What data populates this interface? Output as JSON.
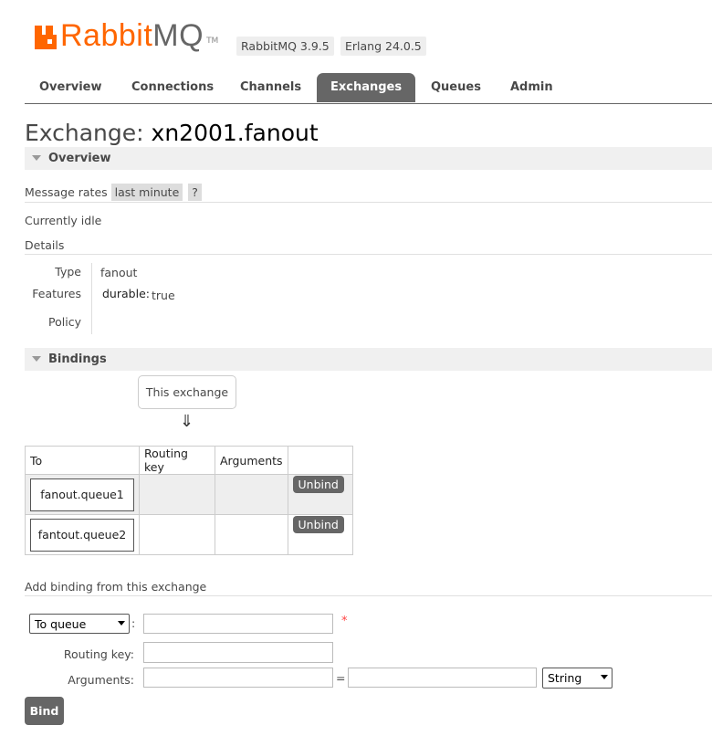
{
  "header": {
    "brand_rabbit": "Rabbit",
    "brand_mq": "MQ",
    "brand_tm": "TM",
    "rabbitmq_version": "RabbitMQ 3.9.5",
    "erlang_version": "Erlang 24.0.5"
  },
  "tabs": [
    {
      "label": "Overview"
    },
    {
      "label": "Connections"
    },
    {
      "label": "Channels"
    },
    {
      "label": "Exchanges"
    },
    {
      "label": "Queues"
    },
    {
      "label": "Admin"
    }
  ],
  "page": {
    "title_prefix": "Exchange: ",
    "title_name": "xn2001.fanout"
  },
  "overview": {
    "section_label": "Overview",
    "message_rates_label": "Message rates",
    "message_rates_period": "last minute",
    "help_label": "?",
    "status": "Currently idle",
    "details_label": "Details",
    "type_label": "Type",
    "type_value": "fanout",
    "features_label": "Features",
    "feature_key": "durable:",
    "feature_value": "true",
    "policy_label": "Policy"
  },
  "bindings": {
    "section_label": "Bindings",
    "this_exchange": "This exchange",
    "arrow": "⇓",
    "columns": [
      "To",
      "Routing key",
      "Arguments",
      ""
    ],
    "rows": [
      {
        "to": "fanout.queue1",
        "action": "Unbind"
      },
      {
        "to": "fantout.queue2",
        "action": "Unbind"
      }
    ]
  },
  "add_binding": {
    "title": "Add binding from this exchange",
    "destination_type": "To queue",
    "colon": ":",
    "required_mark": "*",
    "routing_key_label": "Routing key:",
    "arguments_label": "Arguments:",
    "equals": "=",
    "arg_type": "String",
    "bind_button": "Bind"
  },
  "colors": {
    "brand_orange": "#ff6600",
    "tab_active_bg": "#666666",
    "section_bg": "#f0f0f0"
  }
}
